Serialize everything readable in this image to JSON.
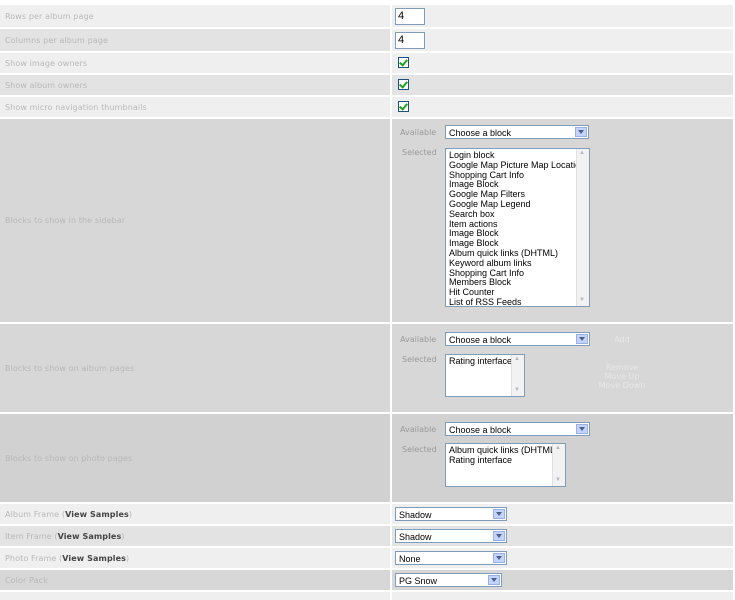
{
  "settings": {
    "rows_per_page": {
      "label": "Rows per album page",
      "value": "4"
    },
    "cols_per_page": {
      "label": "Columns per album page",
      "value": "4"
    },
    "show_image_owners": {
      "label": "Show image owners"
    },
    "show_album_owners": {
      "label": "Show album owners"
    },
    "show_micro_nav": {
      "label": "Show micro navigation thumbnails"
    }
  },
  "available_label": "Available",
  "selected_label": "Selected",
  "choose_block": "Choose a block",
  "sidebar_blocks": {
    "label": "Blocks to show in the sidebar",
    "selected": [
      "Login block",
      "Google Map Picture Map Location",
      "Shopping Cart Info",
      "Image Block",
      "Google Map Filters",
      "Google Map Legend",
      "Search box",
      "Item actions",
      "Image Block",
      "Image Block",
      "Album quick links (DHTML)",
      "Keyword album links",
      "Shopping Cart Info",
      "Members Block",
      "Hit Counter",
      "List of RSS Feeds"
    ]
  },
  "album_blocks": {
    "label": "Blocks to show on album pages",
    "selected": [
      "Rating interface"
    ],
    "actions": {
      "add": "Add",
      "remove": "Remove",
      "move_up": "Move Up",
      "move_down": "Move Down"
    }
  },
  "photo_blocks": {
    "label": "Blocks to show on photo pages",
    "selected": [
      "Album quick links (DHTML)",
      "Rating interface"
    ]
  },
  "frames": {
    "view_samples": "View Samples",
    "album_frame": {
      "label": "Album Frame",
      "value": "Shadow"
    },
    "item_frame": {
      "label": "Item Frame",
      "value": "Shadow"
    },
    "photo_frame": {
      "label": "Photo Frame",
      "value": "None"
    }
  },
  "color_pack": {
    "label": "Color Pack",
    "value": "PG Snow"
  }
}
